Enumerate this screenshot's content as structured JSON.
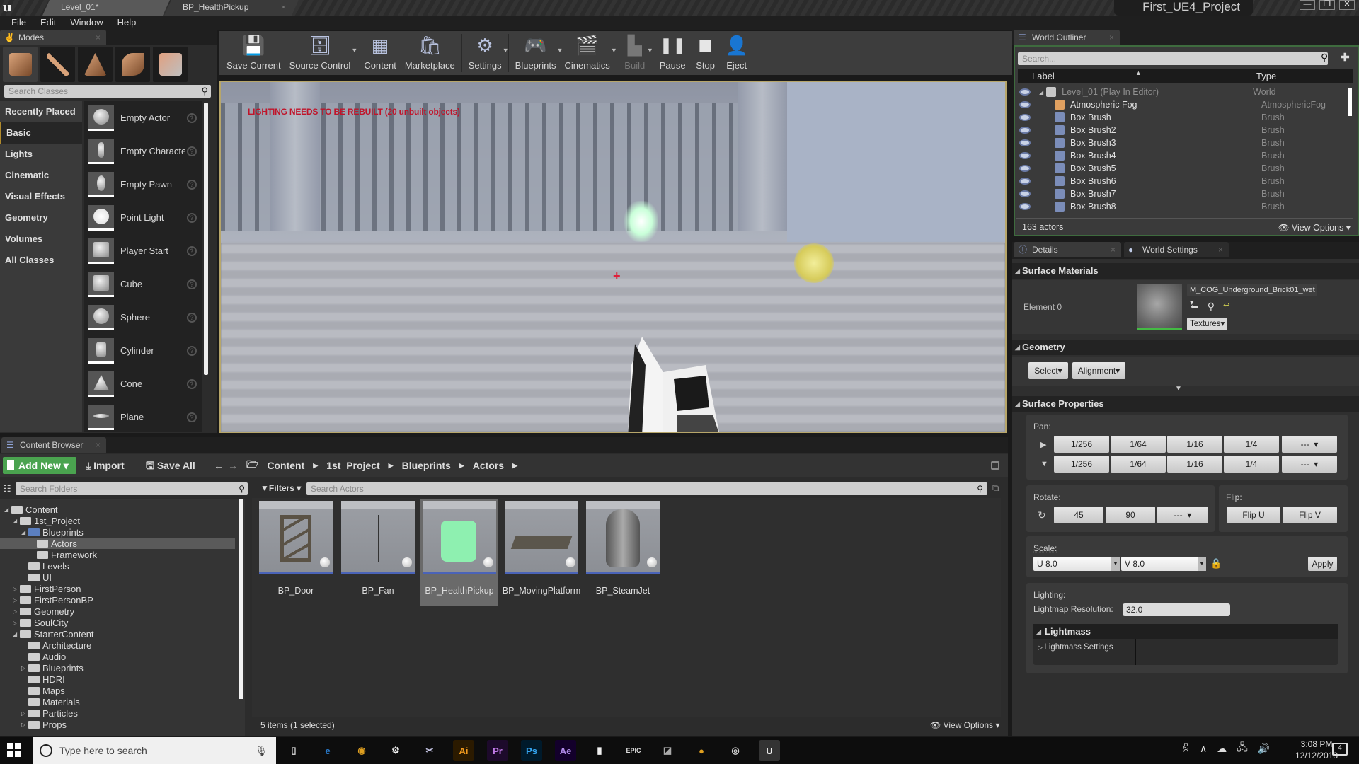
{
  "window": {
    "tabs": [
      {
        "label": "Level_01*",
        "active": true
      },
      {
        "label": "BP_HealthPickup",
        "active": false
      }
    ],
    "project_name": "First_UE4_Project",
    "controls": [
      "—",
      "❐",
      "✕"
    ]
  },
  "menu": [
    "File",
    "Edit",
    "Window",
    "Help"
  ],
  "modes": {
    "tab_label": "Modes",
    "mode_buttons": [
      "place-mode",
      "paint-mode",
      "landscape-mode",
      "foliage-mode",
      "geometry-edit-mode"
    ],
    "search_placeholder": "Search Classes",
    "categories": [
      {
        "label": "Recently Placed",
        "active": false
      },
      {
        "label": "Basic",
        "active": true
      },
      {
        "label": "Lights",
        "active": false
      },
      {
        "label": "Cinematic",
        "active": false
      },
      {
        "label": "Visual Effects",
        "active": false
      },
      {
        "label": "Geometry",
        "active": false
      },
      {
        "label": "Volumes",
        "active": false
      },
      {
        "label": "All Classes",
        "active": false
      }
    ],
    "classes": [
      "Empty Actor",
      "Empty Characte",
      "Empty Pawn",
      "Point Light",
      "Player Start",
      "Cube",
      "Sphere",
      "Cylinder",
      "Cone",
      "Plane"
    ]
  },
  "toolbar": {
    "buttons": [
      {
        "label": "Save Current",
        "icon": "floppy-icon",
        "glyph": "💾",
        "dropdown": false,
        "disabled": false
      },
      {
        "label": "Source Control",
        "icon": "source-control-icon",
        "glyph": "🗄",
        "dropdown": true,
        "disabled": false
      },
      {
        "label": "Content",
        "icon": "content-icon",
        "glyph": "▦",
        "dropdown": false,
        "disabled": false
      },
      {
        "label": "Marketplace",
        "icon": "marketplace-icon",
        "glyph": "🛍",
        "dropdown": false,
        "disabled": false
      },
      {
        "label": "Settings",
        "icon": "gear-icon",
        "glyph": "⚙",
        "dropdown": true,
        "disabled": false
      },
      {
        "label": "Blueprints",
        "icon": "blueprints-icon",
        "glyph": "🎮",
        "dropdown": true,
        "disabled": false
      },
      {
        "label": "Cinematics",
        "icon": "clapperboard-icon",
        "glyph": "🎬",
        "dropdown": true,
        "disabled": false
      },
      {
        "label": "Build",
        "icon": "build-icon",
        "glyph": "▙",
        "dropdown": true,
        "disabled": true
      },
      {
        "label": "Pause",
        "icon": "pause-icon",
        "glyph": "❚❚",
        "dropdown": false,
        "disabled": false
      },
      {
        "label": "Stop",
        "icon": "stop-icon",
        "glyph": "■",
        "dropdown": false,
        "disabled": false
      },
      {
        "label": "Eject",
        "icon": "eject-icon",
        "glyph": "👤",
        "dropdown": false,
        "disabled": false
      }
    ]
  },
  "viewport": {
    "warning": "LIGHTING NEEDS TO BE REBUILT (20 unbuilt objects)",
    "crosshair": "+"
  },
  "world_outliner": {
    "tab_label": "World Outliner",
    "search_placeholder": "Search...",
    "columns": {
      "label": "Label",
      "type": "Type"
    },
    "rows": [
      {
        "label": "Level_01 (Play In Editor)",
        "type": "World",
        "level": true
      },
      {
        "label": "Atmospheric Fog",
        "type": "AtmosphericFog"
      },
      {
        "label": "Box Brush",
        "type": "Brush"
      },
      {
        "label": "Box Brush2",
        "type": "Brush"
      },
      {
        "label": "Box Brush3",
        "type": "Brush"
      },
      {
        "label": "Box Brush4",
        "type": "Brush"
      },
      {
        "label": "Box Brush5",
        "type": "Brush"
      },
      {
        "label": "Box Brush6",
        "type": "Brush"
      },
      {
        "label": "Box Brush7",
        "type": "Brush"
      },
      {
        "label": "Box Brush8",
        "type": "Brush"
      }
    ],
    "actor_count": "163 actors",
    "view_options": "View Options"
  },
  "details": {
    "tabs": [
      {
        "label": "Details"
      },
      {
        "label": "World Settings"
      }
    ],
    "surface_materials": {
      "title": "Surface Materials",
      "element_label": "Element 0",
      "material": "M_COG_Underground_Brick01_wet",
      "textures_label": "Textures"
    },
    "geometry": {
      "title": "Geometry",
      "select_label": "Select",
      "alignment_label": "Alignment"
    },
    "surface_properties": {
      "title": "Surface Properties",
      "pan_label": "Pan:",
      "pan_values": [
        "1/256",
        "1/64",
        "1/16",
        "1/4"
      ],
      "pan_combo": "---",
      "rotate_label": "Rotate:",
      "rotate_values": [
        "45",
        "90"
      ],
      "rotate_combo": "---",
      "flip_label": "Flip:",
      "flip_u": "Flip U",
      "flip_v": "Flip V",
      "scale_label": "Scale:",
      "scale_u": "U  8.0",
      "scale_v": "V  8.0",
      "apply_label": "Apply",
      "lighting_label": "Lighting:",
      "lightmap_label": "Lightmap Resolution:",
      "lightmap_value": "32.0",
      "lightmass_title": "Lightmass",
      "lightmass_settings": "Lightmass Settings"
    }
  },
  "content_browser": {
    "tab_label": "Content Browser",
    "add_new": "Add New",
    "import": "Import",
    "save_all": "Save All",
    "breadcrumb": [
      "Content",
      "1st_Project",
      "Blueprints",
      "Actors"
    ],
    "folder_search_placeholder": "Search Folders",
    "filters_label": "Filters",
    "asset_search_placeholder": "Search Actors",
    "tree": [
      {
        "label": "Content",
        "depth": 0,
        "exp": "◢"
      },
      {
        "label": "1st_Project",
        "depth": 1,
        "exp": "◢"
      },
      {
        "label": "Blueprints",
        "depth": 2,
        "exp": "◢",
        "blue": true
      },
      {
        "label": "Actors",
        "depth": 3,
        "exp": "",
        "selected": true
      },
      {
        "label": "Framework",
        "depth": 3,
        "exp": ""
      },
      {
        "label": "Levels",
        "depth": 2,
        "exp": ""
      },
      {
        "label": "UI",
        "depth": 2,
        "exp": ""
      },
      {
        "label": "FirstPerson",
        "depth": 1,
        "exp": "▷"
      },
      {
        "label": "FirstPersonBP",
        "depth": 1,
        "exp": "▷"
      },
      {
        "label": "Geometry",
        "depth": 1,
        "exp": "▷"
      },
      {
        "label": "SoulCity",
        "depth": 1,
        "exp": "▷"
      },
      {
        "label": "StarterContent",
        "depth": 1,
        "exp": "◢"
      },
      {
        "label": "Architecture",
        "depth": 2,
        "exp": ""
      },
      {
        "label": "Audio",
        "depth": 2,
        "exp": ""
      },
      {
        "label": "Blueprints",
        "depth": 2,
        "exp": "▷"
      },
      {
        "label": "HDRI",
        "depth": 2,
        "exp": ""
      },
      {
        "label": "Maps",
        "depth": 2,
        "exp": ""
      },
      {
        "label": "Materials",
        "depth": 2,
        "exp": ""
      },
      {
        "label": "Particles",
        "depth": 2,
        "exp": "▷"
      },
      {
        "label": "Props",
        "depth": 2,
        "exp": "▷"
      }
    ],
    "assets": [
      {
        "name": "BP_Door",
        "selected": false
      },
      {
        "name": "BP_Fan",
        "selected": false
      },
      {
        "name": "BP_HealthPickup",
        "selected": true
      },
      {
        "name": "BP_MovingPlatform",
        "selected": false
      },
      {
        "name": "BP_SteamJet",
        "selected": false
      }
    ],
    "status": "5 items (1 selected)",
    "view_options": "View Options"
  },
  "taskbar": {
    "search_placeholder": "Type here to search",
    "apps": [
      {
        "name": "task-view",
        "glyph": "▯",
        "bg": "transparent",
        "fg": "#ddd"
      },
      {
        "name": "edge",
        "glyph": "e",
        "bg": "transparent",
        "fg": "#2a7fd4"
      },
      {
        "name": "chrome",
        "glyph": "◉",
        "bg": "transparent",
        "fg": "#e0a020"
      },
      {
        "name": "settings",
        "glyph": "⚙",
        "bg": "transparent",
        "fg": "#eee"
      },
      {
        "name": "snipping",
        "glyph": "✂",
        "bg": "transparent",
        "fg": "#c8c8e8"
      },
      {
        "name": "illustrator",
        "glyph": "Ai",
        "bg": "#2b1a00",
        "fg": "#f29a1e"
      },
      {
        "name": "premiere",
        "glyph": "Pr",
        "bg": "#1d0a2b",
        "fg": "#c17ae8"
      },
      {
        "name": "photoshop",
        "glyph": "Ps",
        "bg": "#001a2b",
        "fg": "#35a6f2"
      },
      {
        "name": "after-effects",
        "glyph": "Ae",
        "bg": "#13002b",
        "fg": "#b08ae8"
      },
      {
        "name": "file",
        "glyph": "▮",
        "bg": "transparent",
        "fg": "#f0f0f0"
      },
      {
        "name": "epic-launcher",
        "glyph": "EPIC",
        "bg": "transparent",
        "fg": "#ddd"
      },
      {
        "name": "app-generic",
        "glyph": "◪",
        "bg": "transparent",
        "fg": "#aaa"
      },
      {
        "name": "app-generic-2",
        "glyph": "●",
        "bg": "transparent",
        "fg": "#e0a020"
      },
      {
        "name": "obs",
        "glyph": "◎",
        "bg": "transparent",
        "fg": "#ccc"
      },
      {
        "name": "unreal",
        "glyph": "U",
        "bg": "#333",
        "fg": "#eee"
      }
    ],
    "time": "3:08 PM",
    "date": "12/12/2018",
    "notifications": "4"
  }
}
